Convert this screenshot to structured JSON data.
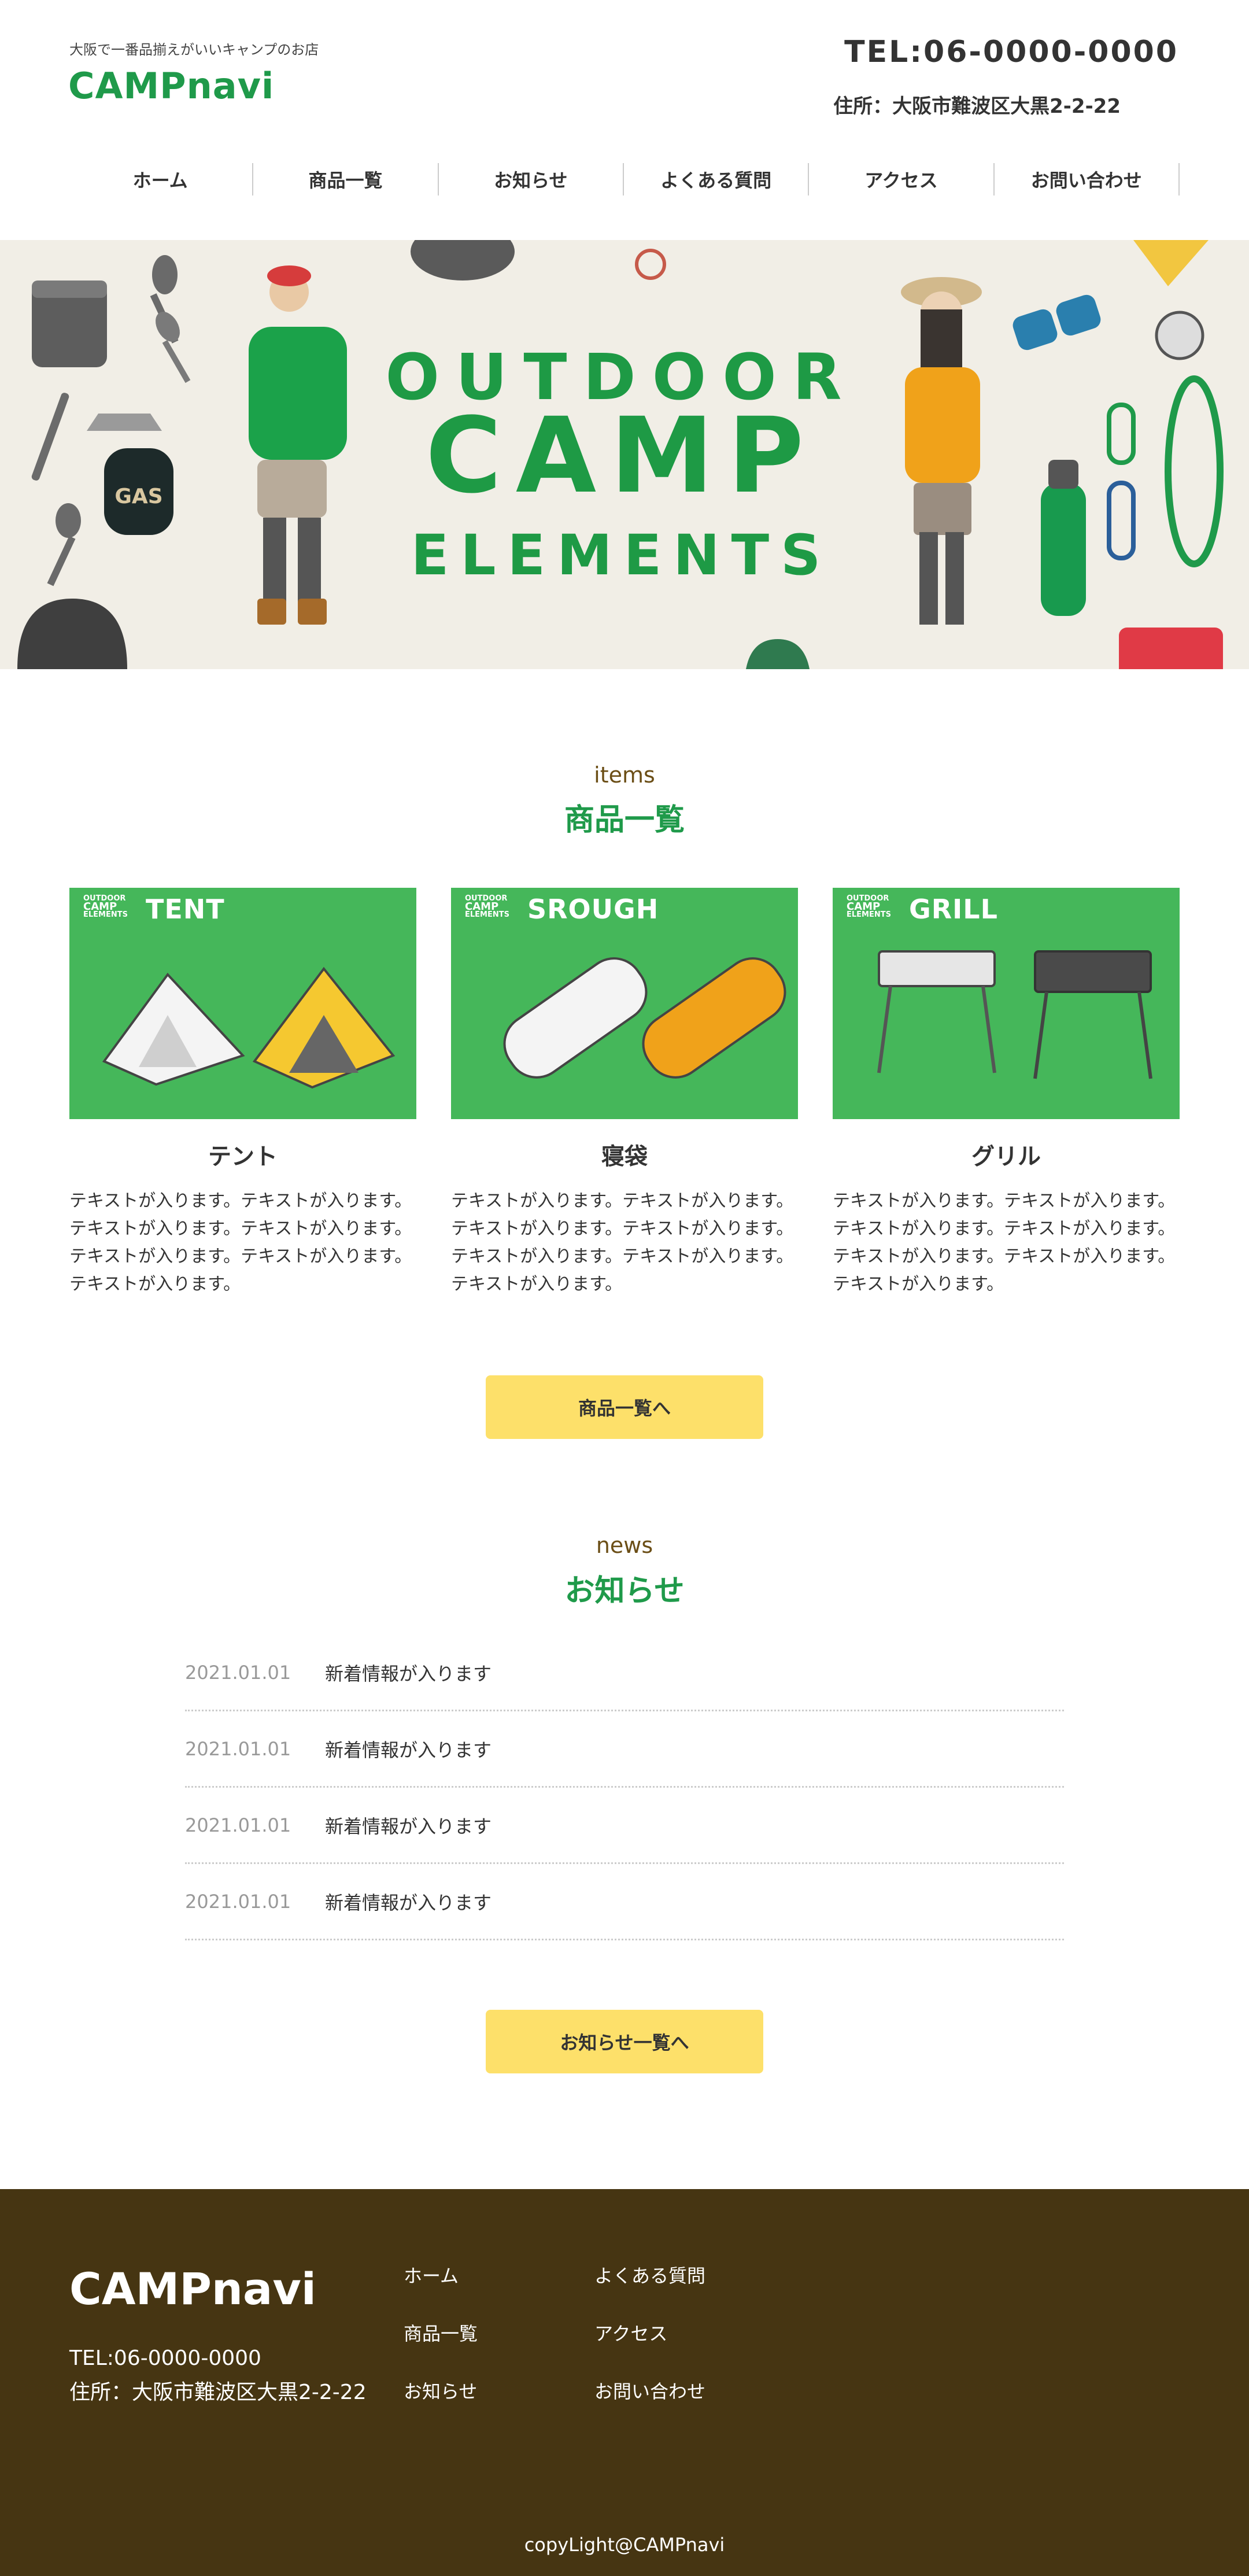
{
  "header": {
    "tagline": "大阪で一番品揃えがいいキャンプのお店",
    "logo": "CAMPnavi",
    "tel": "TEL:06-0000-0000",
    "address": "住所：大阪市難波区大黒2-2-22"
  },
  "nav": [
    "ホーム",
    "商品一覧",
    "お知らせ",
    "よくある質問",
    "アクセス",
    "お問い合わせ"
  ],
  "hero": {
    "line1": "OUTDOOR",
    "line2": "CAMP",
    "line3": "ELEMENTS",
    "gas_label": "GAS"
  },
  "items": {
    "en": "items",
    "title": "商品一覧",
    "badge": [
      "OUTDOOR",
      "CAMP",
      "ELEMENTS"
    ],
    "cards": [
      {
        "label": "TENT",
        "name": "テント",
        "desc": "テキストが入ります。テキストが入ります。テキストが入ります。テキストが入ります。テキストが入ります。テキストが入ります。テキストが入ります。"
      },
      {
        "label": "SROUGH",
        "name": "寝袋",
        "desc": "テキストが入ります。テキストが入ります。テキストが入ります。テキストが入ります。テキストが入ります。テキストが入ります。テキストが入ります。"
      },
      {
        "label": "GRILL",
        "name": "グリル",
        "desc": "テキストが入ります。テキストが入ります。テキストが入ります。テキストが入ります。テキストが入ります。テキストが入ります。テキストが入ります。"
      }
    ],
    "button": "商品一覧へ"
  },
  "news": {
    "en": "news",
    "title": "お知らせ",
    "rows": [
      {
        "date": "2021.01.01",
        "text": "新着情報が入ります"
      },
      {
        "date": "2021.01.01",
        "text": "新着情報が入ります"
      },
      {
        "date": "2021.01.01",
        "text": "新着情報が入ります"
      },
      {
        "date": "2021.01.01",
        "text": "新着情報が入ります"
      }
    ],
    "button": "お知らせ一覧へ"
  },
  "footer": {
    "logo": "CAMPnavi",
    "tel": "TEL:06-0000-0000",
    "address": "住所：大阪市難波区大黒2-2-22",
    "links": [
      "ホーム",
      "商品一覧",
      "お知らせ",
      "よくある質問",
      "アクセス",
      "お問い合わせ"
    ],
    "copyright": "copyLight@CAMPnavi"
  },
  "colors": {
    "brand_green": "#1f9a4a",
    "accent_yellow": "#fde06a",
    "footer_brown": "#463512",
    "hero_bg": "#f1eee6"
  }
}
